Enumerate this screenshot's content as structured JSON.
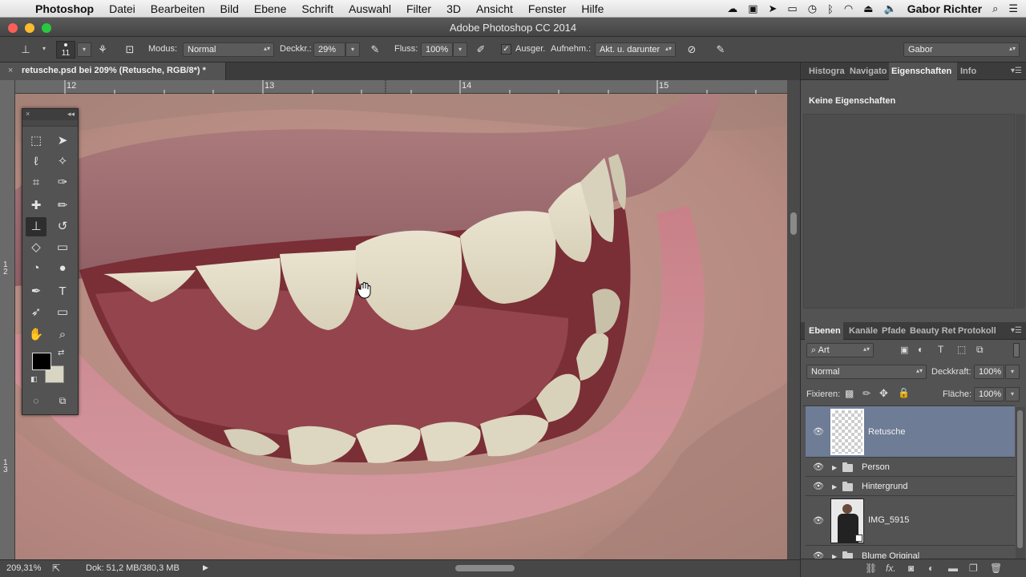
{
  "menubar": {
    "app_name": "Photoshop",
    "items": [
      "Datei",
      "Bearbeiten",
      "Bild",
      "Ebene",
      "Schrift",
      "Auswahl",
      "Filter",
      "3D",
      "Ansicht",
      "Fenster",
      "Hilfe"
    ],
    "user": "Gabor Richter"
  },
  "window": {
    "title": "Adobe Photoshop CC 2014"
  },
  "options": {
    "brush_size": "11",
    "mode_label": "Modus:",
    "mode_value": "Normal",
    "opacity_label": "Deckkr.:",
    "opacity_value": "29%",
    "flow_label": "Fluss:",
    "flow_value": "100%",
    "aligned_label": "Ausger.",
    "sample_label": "Aufnehm.:",
    "sample_value": "Akt. u. darunter",
    "workspace": "Gabor"
  },
  "document": {
    "tab_label": "retusche.psd bei 209% (Retusche, RGB/8*) *",
    "ruler_h": [
      "12",
      "13",
      "14",
      "15"
    ],
    "ruler_v": [
      "1\n2",
      "1\n3"
    ]
  },
  "status": {
    "zoom": "209,31%",
    "doc_info": "Dok: 51,2 MB/380,3 MB"
  },
  "panels": {
    "top_tabs": [
      "Histogra",
      "Navigato",
      "Eigenschaften",
      "Info"
    ],
    "properties_text": "Keine Eigenschaften",
    "layer_tabs": [
      "Ebenen",
      "Kanäle",
      "Pfade",
      "Beauty Ret",
      "Protokoll"
    ],
    "filter_kind": "Art",
    "blend_mode": "Normal",
    "opacity_label": "Deckkraft:",
    "opacity_value": "100%",
    "lock_label": "Fixieren:",
    "fill_label": "Fläche:",
    "fill_value": "100%",
    "layers": [
      {
        "name": "Retusche",
        "type": "pixel",
        "selected": true
      },
      {
        "name": "Person",
        "type": "group"
      },
      {
        "name": "Hintergrund",
        "type": "group"
      },
      {
        "name": "IMG_5915",
        "type": "smart"
      },
      {
        "name": "Blume Original",
        "type": "group"
      }
    ]
  },
  "colors": {
    "selected_layer": "#6e7c96",
    "panel_bg": "#535353",
    "foreground_color": "#000000",
    "background_color": "#d8d5c2"
  }
}
